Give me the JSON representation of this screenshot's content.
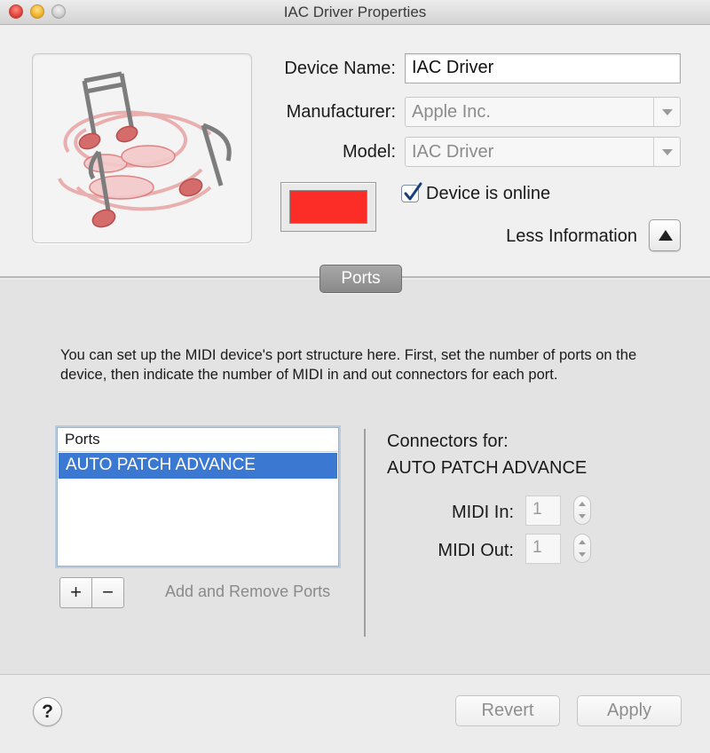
{
  "window": {
    "title": "IAC Driver Properties"
  },
  "device": {
    "name_label": "Device Name:",
    "name_value": "IAC Driver",
    "manufacturer_label": "Manufacturer:",
    "manufacturer_value": "Apple Inc.",
    "model_label": "Model:",
    "model_value": "IAC Driver",
    "icon": "midi-notes-icon",
    "color_swatch": "#fb2d26",
    "online_label": "Device is online",
    "online_checked": true,
    "less_info_label": "Less Information"
  },
  "ports_section": {
    "tab_label": "Ports",
    "description": "You can set up the MIDI device's port structure here.  First, set the number of ports on the device, then indicate the number of MIDI in and out connectors for each port.",
    "list_header": "Ports",
    "ports": [
      "AUTO PATCH ADVANCE"
    ],
    "selected_port": "AUTO PATCH ADVANCE",
    "add_symbol": "+",
    "remove_symbol": "−",
    "add_remove_label": "Add and Remove Ports"
  },
  "connectors": {
    "title": "Connectors for:",
    "port_name": "AUTO PATCH ADVANCE",
    "midi_in_label": "MIDI In:",
    "midi_in_value": "1",
    "midi_out_label": "MIDI Out:",
    "midi_out_value": "1"
  },
  "footer": {
    "help_symbol": "?",
    "revert_label": "Revert",
    "apply_label": "Apply"
  },
  "colors": {
    "selection": "#3b78d2",
    "swatch": "#fb2d26"
  }
}
